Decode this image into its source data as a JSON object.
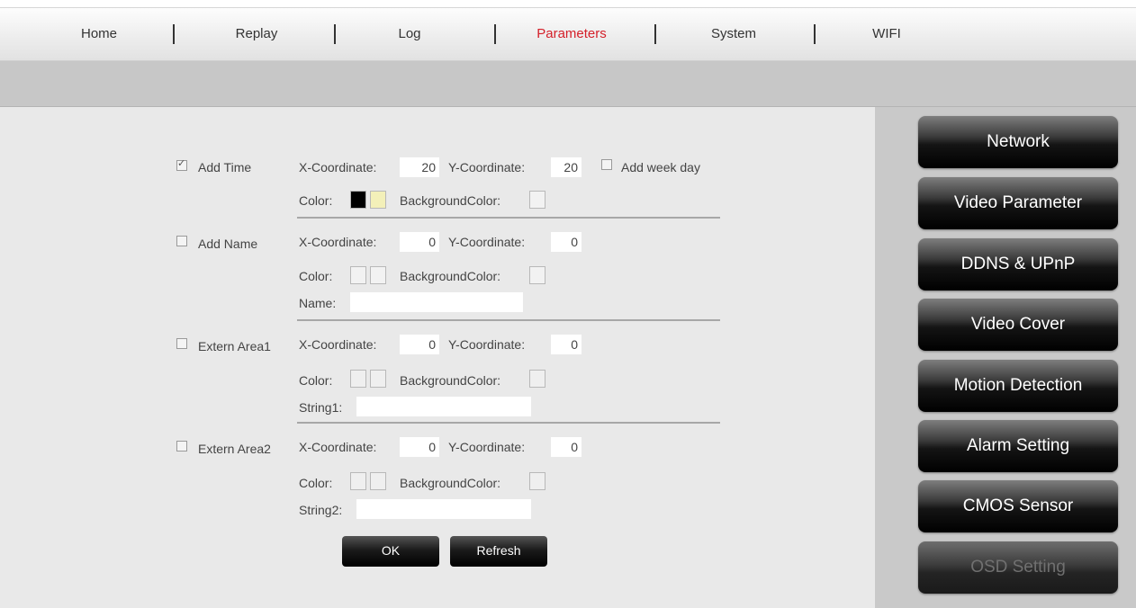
{
  "nav": {
    "items": [
      "Home",
      "Replay",
      "Log",
      "Parameters",
      "System",
      "WIFI"
    ],
    "active": "Parameters",
    "active_color": "#d4202a"
  },
  "sidebar": {
    "items": [
      "Network",
      "Video Parameter",
      "DDNS & UPnP",
      "Video Cover",
      "Motion Detection",
      "Alarm Setting",
      "CMOS Sensor",
      "OSD Setting"
    ],
    "selected": "OSD Setting"
  },
  "osd": {
    "add_time": {
      "label": "Add Time",
      "checked": true,
      "x_label": "X-Coordinate:",
      "x_value": "20",
      "y_label": "Y-Coordinate:",
      "y_value": "20",
      "weekday_label": "Add week day",
      "weekday_checked": false,
      "color_label": "Color:",
      "bg_label": "BackgroundColor:",
      "color_swatches": [
        "#000000",
        "#f3f0b9"
      ],
      "bg_swatch": "#f2f2f2"
    },
    "add_name": {
      "label": "Add Name",
      "checked": false,
      "x_label": "X-Coordinate:",
      "x_value": "0",
      "y_label": "Y-Coordinate:",
      "y_value": "0",
      "color_label": "Color:",
      "bg_label": "BackgroundColor:",
      "name_label": "Name:",
      "name_value": ""
    },
    "extern_area1": {
      "label": "Extern Area1",
      "checked": false,
      "x_label": "X-Coordinate:",
      "x_value": "0",
      "y_label": "Y-Coordinate:",
      "y_value": "0",
      "color_label": "Color:",
      "bg_label": "BackgroundColor:",
      "string_label": "String1:",
      "string_value": ""
    },
    "extern_area2": {
      "label": "Extern Area2",
      "checked": false,
      "x_label": "X-Coordinate:",
      "x_value": "0",
      "y_label": "Y-Coordinate:",
      "y_value": "0",
      "color_label": "Color:",
      "bg_label": "BackgroundColor:",
      "string_label": "String2:",
      "string_value": ""
    },
    "buttons": {
      "ok": "OK",
      "refresh": "Refresh"
    }
  }
}
